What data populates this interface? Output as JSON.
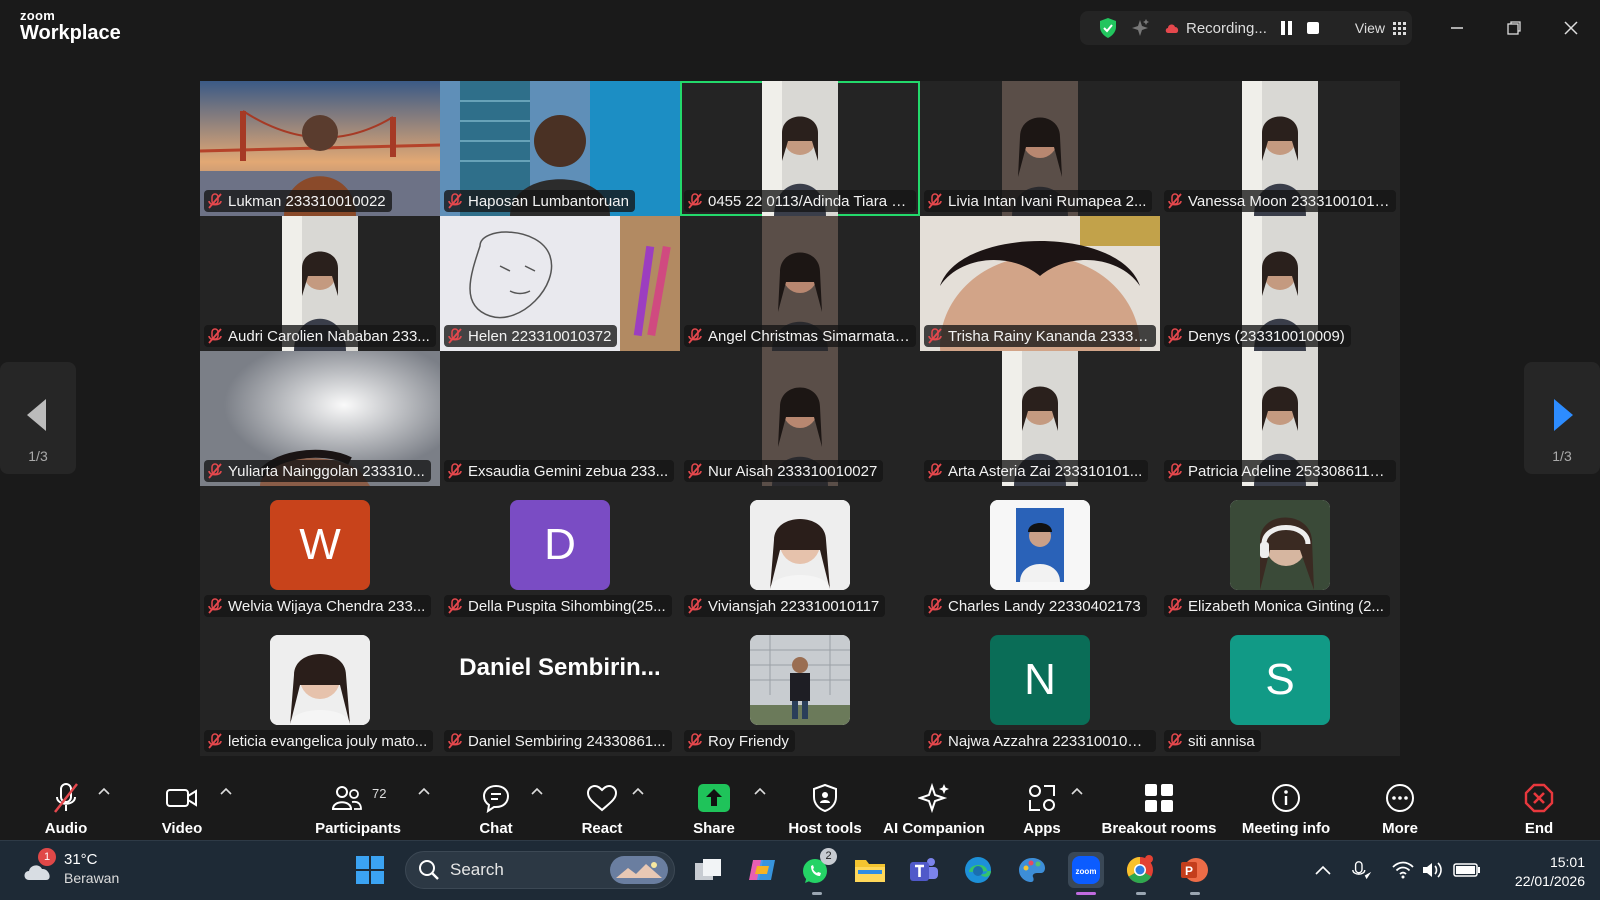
{
  "app": {
    "brand_small": "zoom",
    "brand_big": "Workplace"
  },
  "recording": {
    "status": "Recording...",
    "view_label": "View"
  },
  "pager": {
    "left_label": "1/3",
    "right_label": "1/3"
  },
  "participants": [
    {
      "name": "Lukman 233310010022",
      "kind": "video",
      "scene": "bridge"
    },
    {
      "name": "Haposan Lumbantoruan",
      "kind": "video",
      "scene": "building"
    },
    {
      "name": "0455 22 0113/Adinda Tiara grec...",
      "kind": "video",
      "scene": "person-light",
      "speaking": true
    },
    {
      "name": "Livia Intan Ivani Rumapea 2...",
      "kind": "video",
      "scene": "person-dark"
    },
    {
      "name": "Vanessa Moon 233310010105",
      "kind": "video",
      "scene": "person-light"
    },
    {
      "name": "Audri Carolien Nababan 233...",
      "kind": "video",
      "scene": "person-light"
    },
    {
      "name": "Helen 223310010372",
      "kind": "video",
      "scene": "sketch"
    },
    {
      "name": "Angel Christmas Simarmata ...",
      "kind": "video",
      "scene": "person-dark"
    },
    {
      "name": "Trisha Rainy Kananda 23331...",
      "kind": "video",
      "scene": "forehead"
    },
    {
      "name": "Denys (233310010009)",
      "kind": "video",
      "scene": "person-light"
    },
    {
      "name": "Yuliarta Nainggolan 233310...",
      "kind": "video",
      "scene": "ceiling"
    },
    {
      "name": "Exsaudia Gemini zebua 233...",
      "kind": "empty"
    },
    {
      "name": "Nur Aisah 233310010027",
      "kind": "video",
      "scene": "person-dark"
    },
    {
      "name": "Arta Asteria Zai 233310101...",
      "kind": "video",
      "scene": "person-light"
    },
    {
      "name": "Patricia Adeline 2533086118...",
      "kind": "video",
      "scene": "person-light"
    },
    {
      "name": "Welvia Wijaya Chendra 233...",
      "kind": "avatar",
      "letter": "W",
      "color": "#c8431b"
    },
    {
      "name": "Della Puspita Sihombing(25...",
      "kind": "avatar",
      "letter": "D",
      "color": "#7a4cc4"
    },
    {
      "name": "Viviansjah 223310010117",
      "kind": "photo",
      "scene": "portrait"
    },
    {
      "name": "Charles Landy 22330402173",
      "kind": "photo",
      "scene": "idphoto"
    },
    {
      "name": "Elizabeth Monica Ginting (2...",
      "kind": "photo",
      "scene": "headphones"
    },
    {
      "name": "leticia evangelica jouly mato...",
      "kind": "photo",
      "scene": "portrait"
    },
    {
      "name": "Daniel Sembiring 24330861...",
      "kind": "textname",
      "display": "Daniel  Sembirin..."
    },
    {
      "name": "Roy Friendy",
      "kind": "photo",
      "scene": "outdoor"
    },
    {
      "name": "Najwa Azzahra 223310010074",
      "kind": "avatar",
      "letter": "N",
      "color": "#0a6d57"
    },
    {
      "name": "siti annisa",
      "kind": "avatar",
      "letter": "S",
      "color": "#119a86"
    }
  ],
  "toolbar": {
    "audio": "Audio",
    "video": "Video",
    "participants": "Participants",
    "participants_count": "72",
    "chat": "Chat",
    "react": "React",
    "share": "Share",
    "host_tools": "Host tools",
    "ai_companion": "AI Companion",
    "apps": "Apps",
    "breakout_rooms": "Breakout rooms",
    "meeting_info": "Meeting info",
    "more": "More",
    "end": "End"
  },
  "taskbar": {
    "temperature": "31°C",
    "weather_desc": "Berawan",
    "weather_badge": "1",
    "search_placeholder": "Search",
    "whatsapp_badge": "2",
    "time": "15:01",
    "date": "22/01/2026"
  },
  "colors": {
    "accent_green": "#23d96b",
    "share_green": "#1fc35a",
    "end_red": "#e8383d",
    "muted_red": "#e5484d"
  }
}
